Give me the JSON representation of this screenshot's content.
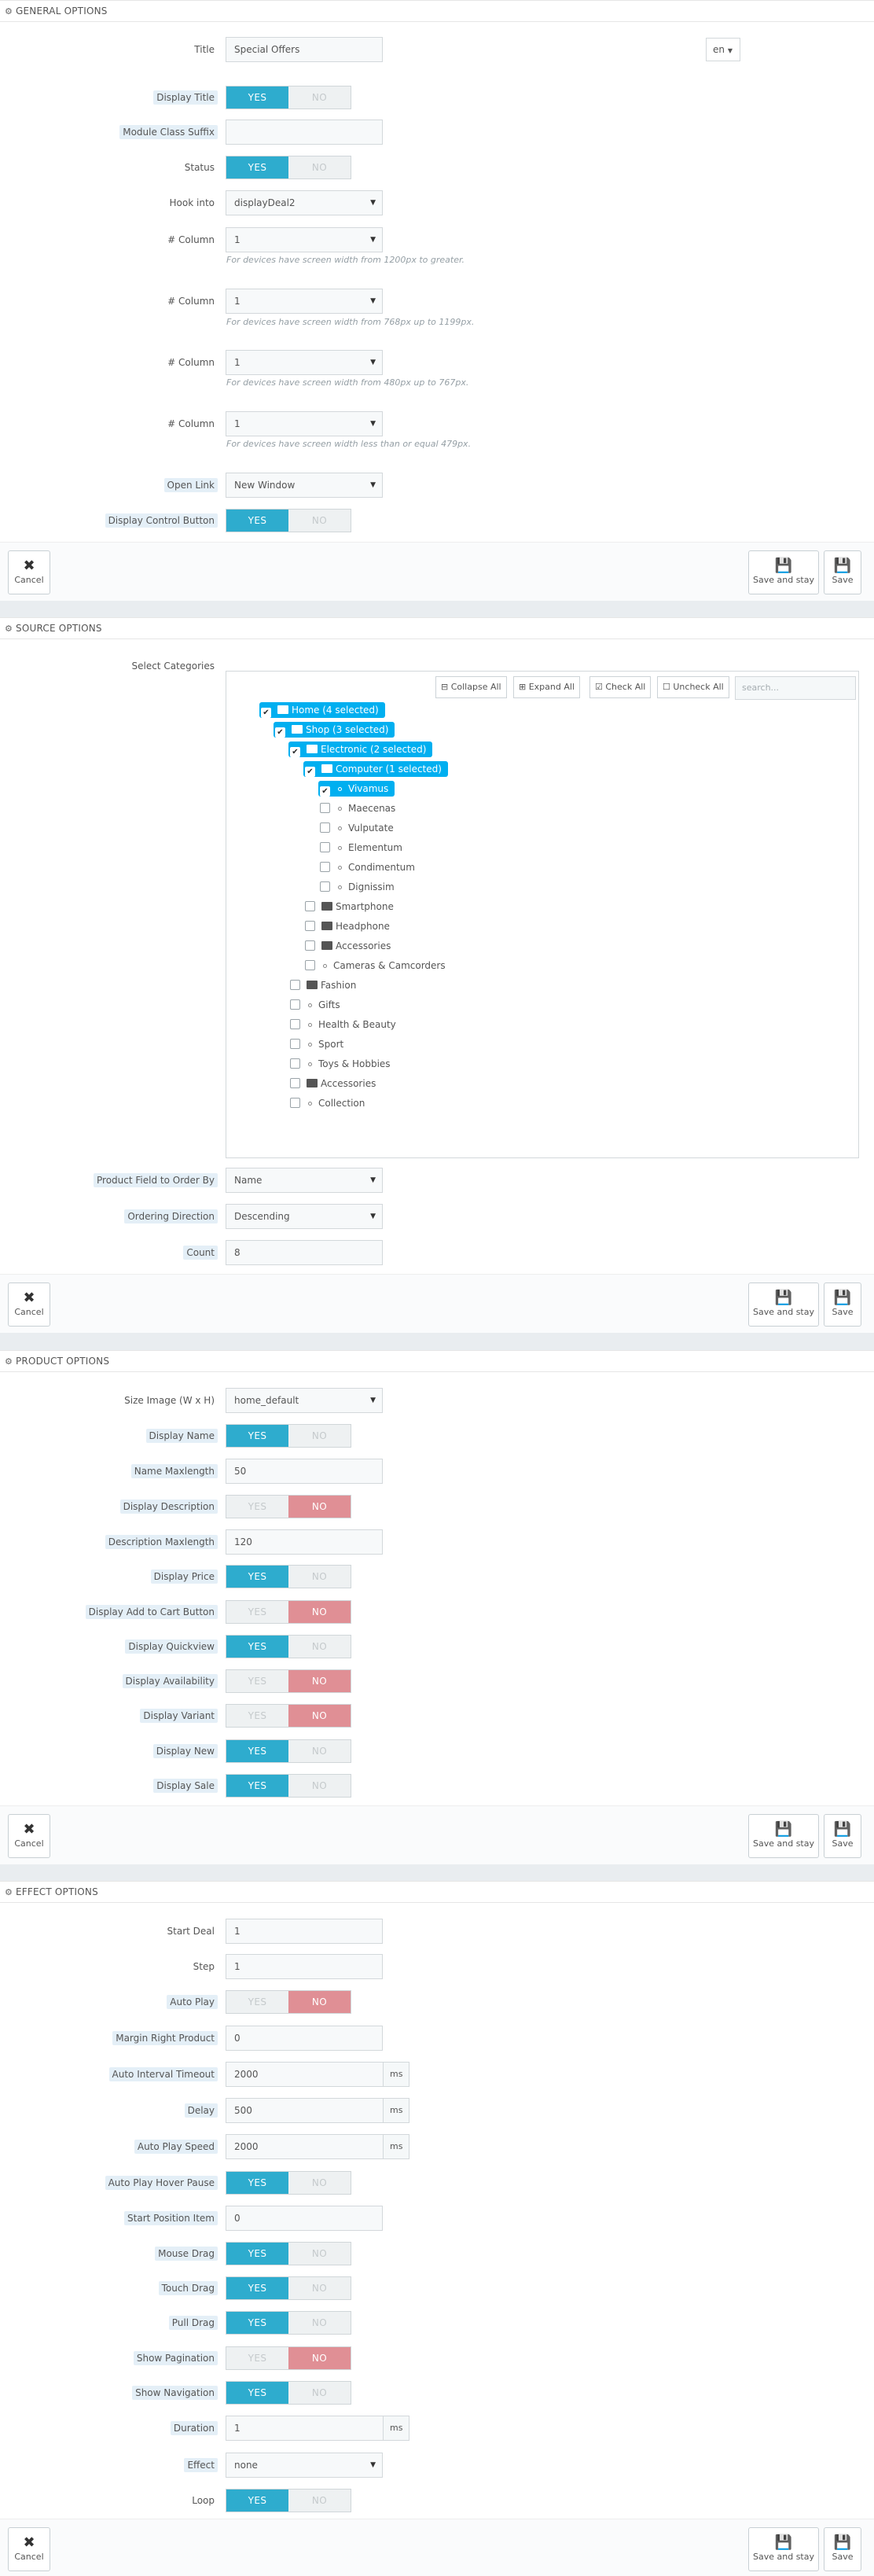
{
  "actions": {
    "cancel": "Cancel",
    "save_stay": "Save and stay",
    "save": "Save"
  },
  "units": {
    "ms": "ms"
  },
  "general": {
    "header": "GENERAL OPTIONS",
    "title_label": "Title",
    "title_value": "Special Offers",
    "lang": "en",
    "display_title_label": "Display Title",
    "suffix_label": "Module Class Suffix",
    "suffix_value": "",
    "status_label": "Status",
    "hook_label": "Hook into",
    "hook_value": "displayDeal2",
    "column_label": "# Column",
    "col1_value": "1",
    "col1_help": "For devices have screen width from 1200px to greater.",
    "col2_value": "1",
    "col2_help": "For devices have screen width from 768px up to 1199px.",
    "col3_value": "1",
    "col3_help": "For devices have screen width from 480px up to 767px.",
    "col4_value": "1",
    "col4_help": "For devices have screen width less than or equal 479px.",
    "open_link_label": "Open Link",
    "open_link_value": "New Window",
    "display_control_label": "Display Control Button"
  },
  "toggle": {
    "yes": "YES",
    "no": "NO"
  },
  "source": {
    "header": "SOURCE OPTIONS",
    "categories_label": "Select Categories",
    "collapse_all": "Collapse All",
    "expand_all": "Expand All",
    "check_all": "Check All",
    "uncheck_all": "Uncheck All",
    "search_placeholder": "search...",
    "tree": {
      "home": "Home (4 selected)",
      "shop": "Shop (3 selected)",
      "electronic": "Electronic (2 selected)",
      "computer": "Computer (1 selected)",
      "vivamus": "Vivamus",
      "maecenas": "Maecenas",
      "vulputate": "Vulputate",
      "elementum": "Elementum",
      "condimentum": "Condimentum",
      "dignissim": "Dignissim",
      "smartphone": "Smartphone",
      "headphone": "Headphone",
      "accessories1": "Accessories",
      "cameras": "Cameras & Camcorders",
      "fashion": "Fashion",
      "gifts": "Gifts",
      "health": "Health & Beauty",
      "sport": "Sport",
      "toys": "Toys & Hobbies",
      "accessories2": "Accessories",
      "collection": "Collection"
    },
    "order_by_label": "Product Field to Order By",
    "order_by_value": "Name",
    "direction_label": "Ordering Direction",
    "direction_value": "Descending",
    "count_label": "Count",
    "count_value": "8"
  },
  "product": {
    "header": "PRODUCT OPTIONS",
    "size_label": "Size Image (W x H)",
    "size_value": "home_default",
    "display_name": "Display Name",
    "name_max_label": "Name Maxlength",
    "name_max_value": "50",
    "display_desc": "Display Description",
    "desc_max_label": "Description Maxlength",
    "desc_max_value": "120",
    "display_price": "Display Price",
    "display_cart": "Display Add to Cart Button",
    "display_quickview": "Display Quickview",
    "display_availability": "Display Availability",
    "display_variant": "Display Variant",
    "display_new": "Display New",
    "display_sale": "Display Sale"
  },
  "effect": {
    "header": "EFFECT OPTIONS",
    "start_deal_label": "Start Deal",
    "start_deal_value": "1",
    "step_label": "Step",
    "step_value": "1",
    "auto_play": "Auto Play",
    "margin_label": "Margin Right Product",
    "margin_value": "0",
    "interval_label": "Auto Interval Timeout",
    "interval_value": "2000",
    "delay_label": "Delay",
    "delay_value": "500",
    "speed_label": "Auto Play Speed",
    "speed_value": "2000",
    "hover_pause": "Auto Play Hover Pause",
    "start_pos_label": "Start Position Item",
    "start_pos_value": "0",
    "mouse_drag": "Mouse Drag",
    "touch_drag": "Touch Drag",
    "pull_drag": "Pull Drag",
    "show_pagination": "Show Pagination",
    "show_navigation": "Show Navigation",
    "duration_label": "Duration",
    "duration_value": "1",
    "effect_label": "Effect",
    "effect_value": "none",
    "loop": "Loop"
  }
}
